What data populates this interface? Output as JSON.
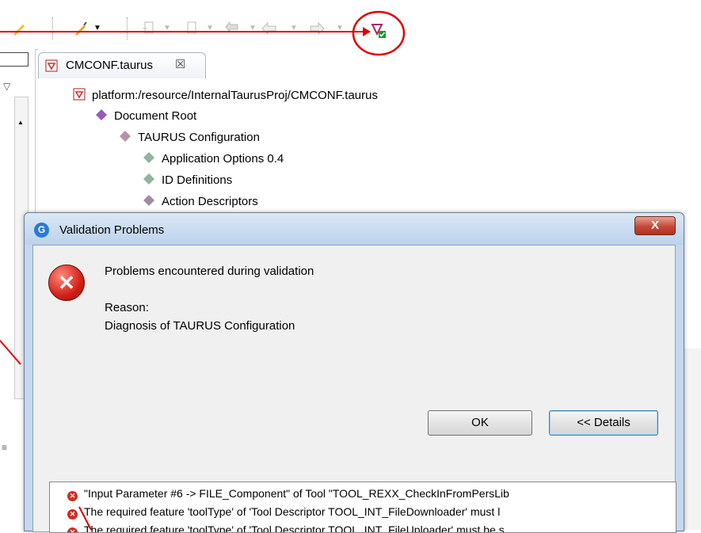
{
  "editor": {
    "tab_label": "CMCONF.taurus",
    "tab_close": "☒",
    "tree": [
      "platform:/resource/InternalTaurusProj/CMCONF.taurus",
      "Document Root",
      "TAURUS Configuration",
      "Application Options 0.4",
      "ID Definitions",
      "Action Descriptors"
    ]
  },
  "dialog": {
    "title": "Validation Problems",
    "close": "X",
    "message": "Problems encountered during validation",
    "reason_label": "Reason:",
    "reason_text": "Diagnosis of TAURUS Configuration",
    "ok_label": "OK",
    "details_label": "<< Details",
    "details": [
      "\"Input Parameter #6 -> FILE_Component\" of Tool \"TOOL_REXX_CheckInFromPersLib",
      "The required feature 'toolType' of 'Tool Descriptor TOOL_INT_FileDownloader' must l",
      "The required feature 'toolType' of 'Tool Descriptor TOOL_INT_FileUploader' must be s"
    ]
  },
  "colors": {
    "annotation_red": "#e00000",
    "validate_icon_green": "#1a9a2a",
    "tree_purple": "#8b3a9a"
  }
}
